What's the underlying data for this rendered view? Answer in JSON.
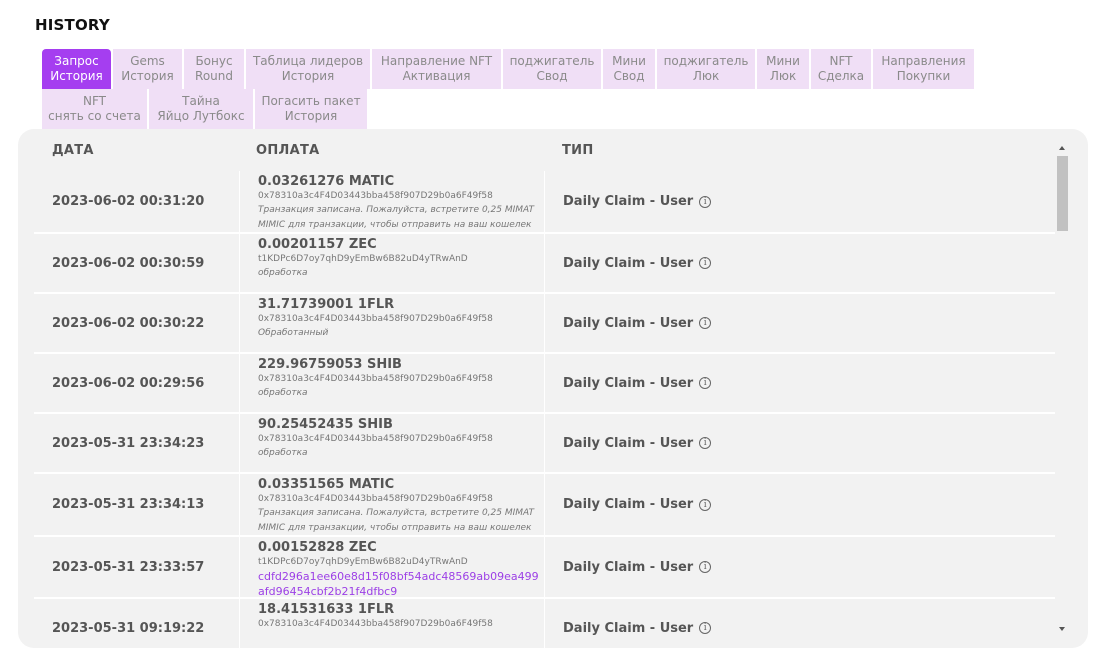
{
  "page": {
    "title": "HISTORY"
  },
  "tabs": {
    "row1": [
      {
        "line1": "Запрос",
        "line2": "История",
        "active": true
      },
      {
        "line1": "Gems",
        "line2": "История"
      },
      {
        "line1": "Бонус",
        "line2": "Round"
      },
      {
        "line1": "Таблица лидеров",
        "line2": "История"
      },
      {
        "line1": "Направление NFT",
        "line2": "Активация"
      },
      {
        "line1": "поджигатель",
        "line2": "Свод"
      },
      {
        "line1": "Мини",
        "line2": "Свод"
      },
      {
        "line1": "поджигатель",
        "line2": "Люк"
      },
      {
        "line1": "Мини",
        "line2": "Люк"
      },
      {
        "line1": "NFT",
        "line2": "Сделка"
      },
      {
        "line1": "Направления",
        "line2": "Покупки"
      }
    ],
    "row2": [
      {
        "line1": "NFT",
        "line2": "снять со счета"
      },
      {
        "line1": "Тайна",
        "line2": "Яйцо Лутбокс"
      },
      {
        "line1": "Погасить пакет",
        "line2": "История"
      }
    ]
  },
  "table": {
    "headers": {
      "date": "ДАТА",
      "payment": "ОПЛАТА",
      "type": "ТИП"
    },
    "rows": [
      {
        "date": "2023-06-02 00:31:20",
        "amount": "0.03261276 MATIC",
        "address": "0x78310a3c4F4D03443bba458f907D29b0a6F49f58",
        "note": "Транзакция записана. Пожалуйста, встретите 0,25 MIMAT MIMIC для транзакции, чтобы отправить на ваш кошелек",
        "type": "Daily Claim - User"
      },
      {
        "date": "2023-06-02 00:30:59",
        "amount": "0.00201157 ZEC",
        "address": "t1KDPc6D7oy7qhD9yEmBw6B82uD4yTRwAnD",
        "note": "обработка",
        "type": "Daily Claim - User"
      },
      {
        "date": "2023-06-02 00:30:22",
        "amount": "31.71739001 1FLR",
        "address": "0x78310a3c4F4D03443bba458f907D29b0a6F49f58",
        "note": "Обработанный",
        "type": "Daily Claim - User"
      },
      {
        "date": "2023-06-02 00:29:56",
        "amount": "229.96759053 SHIB",
        "address": "0x78310a3c4F4D03443bba458f907D29b0a6F49f58",
        "note": "обработка",
        "type": "Daily Claim - User"
      },
      {
        "date": "2023-05-31 23:34:23",
        "amount": "90.25452435 SHIB",
        "address": "0x78310a3c4F4D03443bba458f907D29b0a6F49f58",
        "note": "обработка",
        "type": "Daily Claim - User"
      },
      {
        "date": "2023-05-31 23:34:13",
        "amount": "0.03351565 MATIC",
        "address": "0x78310a3c4F4D03443bba458f907D29b0a6F49f58",
        "note": "Транзакция записана. Пожалуйста, встретите 0,25 MIMAT MIMIC для транзакции, чтобы отправить на ваш кошелек",
        "type": "Daily Claim - User"
      },
      {
        "date": "2023-05-31 23:33:57",
        "amount": "0.00152828 ZEC",
        "address": "t1KDPc6D7oy7qhD9yEmBw6B82uD4yTRwAnD",
        "txhash": "cdfd296a1ee60e8d15f08bf54adc48569ab09ea499afd96454cbf2b21f4dfbc9",
        "type": "Daily Claim - User"
      },
      {
        "date": "2023-05-31 09:19:22",
        "amount": "18.41531633 1FLR",
        "address": "0x78310a3c4F4D03443bba458f907D29b0a6F49f58",
        "type": "Daily Claim - User"
      }
    ]
  },
  "colors": {
    "accent": "#a53ef0",
    "tab_bg": "#f0dff6",
    "panel_bg": "#f2f2f2",
    "link": "#9c3fe6"
  },
  "icons": {
    "info": "info-circle-icon"
  }
}
